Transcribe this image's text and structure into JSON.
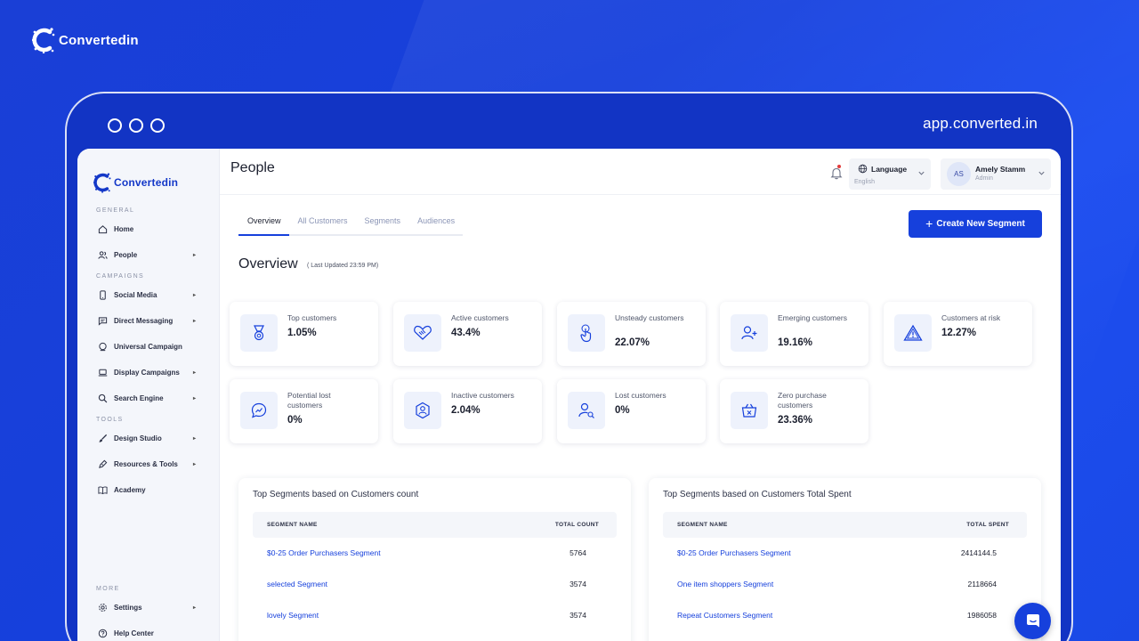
{
  "brand": {
    "name": "Convertedin"
  },
  "browser": {
    "url": "app.converted.in"
  },
  "sidebar": {
    "logo": "Convertedin",
    "sections": {
      "general": "GENERAL",
      "campaigns": "CAMPAIGNS",
      "tools": "TOOLS",
      "more": "MORE"
    },
    "items": [
      {
        "label": "Home",
        "icon": "home-icon"
      },
      {
        "label": "People",
        "icon": "people-icon"
      },
      {
        "label": "Social Media",
        "icon": "phone-icon"
      },
      {
        "label": "Direct Messaging",
        "icon": "message-icon"
      },
      {
        "label": "Universal Campaign",
        "icon": "globe-icon"
      },
      {
        "label": "Display Campaigns",
        "icon": "laptop-icon"
      },
      {
        "label": "Search Engine",
        "icon": "search-icon"
      },
      {
        "label": "Design Studio",
        "icon": "brush-icon"
      },
      {
        "label": "Resources & Tools",
        "icon": "pen-icon"
      },
      {
        "label": "Academy",
        "icon": "book-icon"
      },
      {
        "label": "Settings",
        "icon": "gear-icon"
      },
      {
        "label": "Help Center",
        "icon": "help-icon"
      }
    ]
  },
  "header": {
    "title": "People",
    "language": {
      "label": "Language",
      "value": "English"
    },
    "user": {
      "initials": "AS",
      "name": "Amely Stamm",
      "role": "Admin"
    }
  },
  "tabs": [
    {
      "label": "Overview",
      "active": true
    },
    {
      "label": "All Customers",
      "active": false
    },
    {
      "label": "Segments",
      "active": false
    },
    {
      "label": "Audiences",
      "active": false
    }
  ],
  "create_button": "Create New Segment",
  "overview": {
    "title": "Overview",
    "updated": "( Last Updated 23:59 PM)",
    "cards": [
      {
        "label": "Top customers",
        "value": "1.05%",
        "icon": "medal-icon"
      },
      {
        "label": "Active customers",
        "value": "43.4%",
        "icon": "handshake-icon"
      },
      {
        "label": "Unsteady customers",
        "value": "22.07%",
        "icon": "tap-icon"
      },
      {
        "label": "Emerging customers",
        "value": "19.16%",
        "icon": "user-plus-icon"
      },
      {
        "label": "Customers at risk",
        "value": "12.27%",
        "icon": "warning-icon"
      },
      {
        "label": "Potential lost customers",
        "value": "0%",
        "icon": "chat-trend-icon"
      },
      {
        "label": "Inactive customers",
        "value": "2.04%",
        "icon": "user-shield-icon"
      },
      {
        "label": "Lost customers",
        "value": "0%",
        "icon": "user-search-icon"
      },
      {
        "label": "Zero purchase customers",
        "value": "23.36%",
        "icon": "basket-icon"
      }
    ]
  },
  "tables": [
    {
      "title": "Top Segments based on Customers count",
      "col1": "SEGMENT NAME",
      "col2": "TOTAL COUNT",
      "rows": [
        {
          "name": "$0-25 Order Purchasers Segment",
          "value": "5764"
        },
        {
          "name": "selected Segment",
          "value": "3574"
        },
        {
          "name": "lovely Segment",
          "value": "3574"
        }
      ]
    },
    {
      "title": "Top Segments based on Customers Total Spent",
      "col1": "SEGMENT NAME",
      "col2": "TOTAL SPENT",
      "rows": [
        {
          "name": "$0-25 Order Purchasers Segment",
          "value": "2414144.5"
        },
        {
          "name": "One item shoppers Segment",
          "value": "2118664"
        },
        {
          "name": "Repeat Customers Segment",
          "value": "1986058"
        }
      ]
    }
  ],
  "colors": {
    "primary": "#1640dc",
    "background": "#1a3fd6",
    "text": "#1b1f2e"
  }
}
